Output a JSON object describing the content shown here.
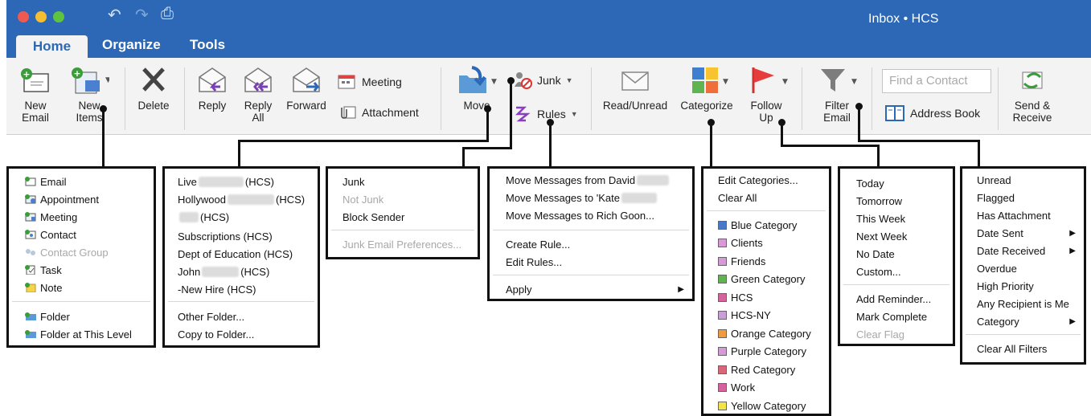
{
  "window": {
    "title": "Inbox • HCS"
  },
  "tabs": [
    "Home",
    "Organize",
    "Tools"
  ],
  "ribbon": {
    "new_email": [
      "New",
      "Email"
    ],
    "new_items": [
      "New",
      "Items"
    ],
    "delete": "Delete",
    "reply": "Reply",
    "reply_all": [
      "Reply",
      "All"
    ],
    "forward": "Forward",
    "meeting": "Meeting",
    "attachment": "Attachment",
    "move": "Move",
    "junk": "Junk",
    "rules": "Rules",
    "read_unread": "Read/Unread",
    "categorize": "Categorize",
    "follow_up": [
      "Follow",
      "Up"
    ],
    "filter_email": [
      "Filter",
      "Email"
    ],
    "find_contact_placeholder": "Find a Contact",
    "address_book": "Address Book",
    "send_receive": [
      "Send &",
      "Receive"
    ]
  },
  "menus": {
    "new_items": {
      "items": [
        "Email",
        "Appointment",
        "Meeting",
        "Contact",
        "Contact Group",
        "Task",
        "Note"
      ],
      "disabled": [
        "Contact Group"
      ],
      "items2": [
        "Folder",
        "Folder at This Level"
      ]
    },
    "move": {
      "items": [
        {
          "pre": "Live",
          "post": "(HCS)"
        },
        {
          "pre": "Hollywood",
          "post": "(HCS)"
        },
        {
          "pre": "",
          "post": "(HCS)"
        },
        {
          "pre": "Subscriptions (HCS)",
          "post": ""
        },
        {
          "pre": "Dept of Education (HCS)",
          "post": ""
        },
        {
          "pre": "John",
          "post": "(HCS)"
        },
        {
          "pre": "-New Hire (HCS)",
          "post": ""
        }
      ],
      "items2": [
        "Other Folder...",
        "Copy to Folder..."
      ]
    },
    "junk": {
      "items": [
        "Junk",
        "Not Junk",
        "Block Sender"
      ],
      "items2": [
        "Junk Email Preferences..."
      ]
    },
    "rules": {
      "items": [
        "Move Messages from David",
        "Move Messages to 'Kate",
        "Move Messages to Rich Goon..."
      ],
      "items2": [
        "Create Rule...",
        "Edit Rules..."
      ],
      "items3": [
        "Apply"
      ]
    },
    "categorize": {
      "items": [
        "Edit Categories...",
        "Clear All"
      ],
      "categories": [
        {
          "name": "Blue Category",
          "color": "#4a78c9"
        },
        {
          "name": "Clients",
          "color": "#d79ad6"
        },
        {
          "name": "Friends",
          "color": "#d79ad6"
        },
        {
          "name": "Green Category",
          "color": "#5fb450"
        },
        {
          "name": "HCS",
          "color": "#d4629c"
        },
        {
          "name": "HCS-NY",
          "color": "#c9a0d6"
        },
        {
          "name": "Orange Category",
          "color": "#f29a3c"
        },
        {
          "name": "Purple Category",
          "color": "#d79ad6"
        },
        {
          "name": "Red Category",
          "color": "#d9677a"
        },
        {
          "name": "Work",
          "color": "#d4629c"
        },
        {
          "name": "Yellow Category",
          "color": "#f2e34a"
        }
      ]
    },
    "follow_up": {
      "items": [
        "Today",
        "Tomorrow",
        "This Week",
        "Next Week",
        "No Date",
        "Custom..."
      ],
      "items2": [
        "Add Reminder...",
        "Mark Complete",
        "Clear Flag"
      ]
    },
    "filter": {
      "items": [
        "Unread",
        "Flagged",
        "Has Attachment",
        "Date Sent",
        "Date Received",
        "Overdue",
        "High Priority",
        "Any Recipient is Me",
        "Category"
      ],
      "items2": [
        "Clear All Filters"
      ]
    }
  }
}
